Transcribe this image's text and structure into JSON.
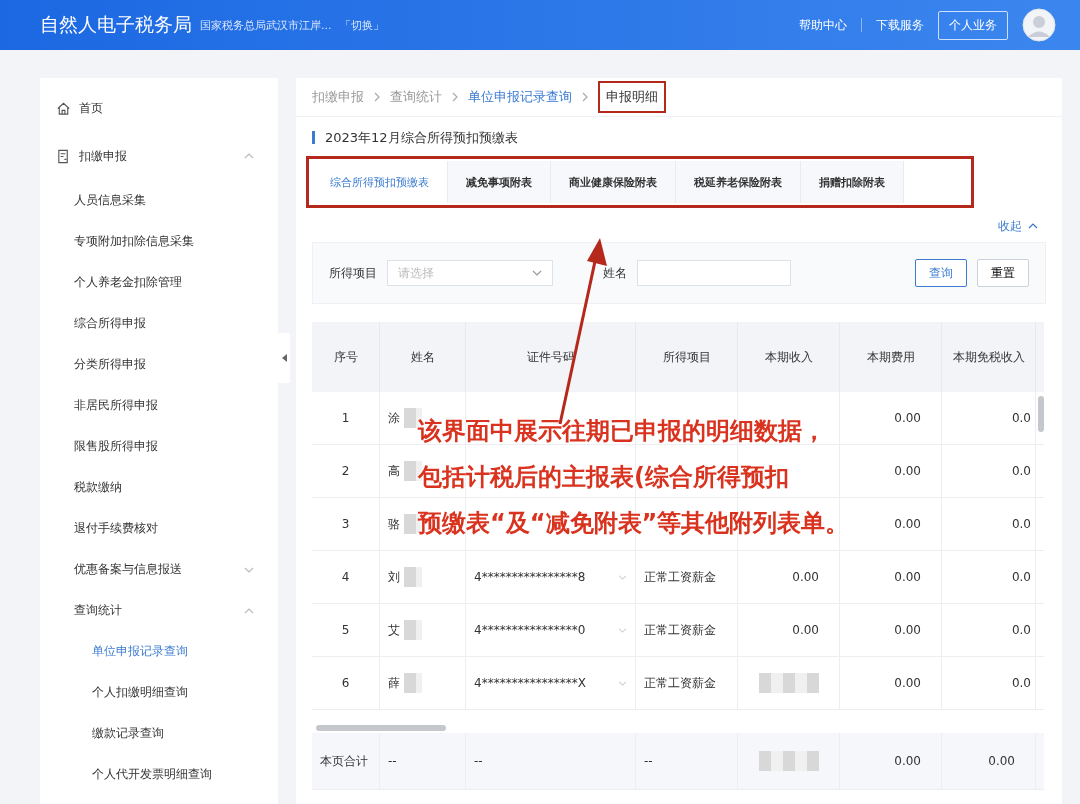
{
  "header": {
    "title": "自然人电子税务局",
    "org": "国家税务总局武汉市江岸...",
    "switch": "「切换」",
    "links": [
      "帮助中心",
      "下载服务"
    ],
    "button": "个人业务"
  },
  "sidebar": {
    "items": [
      {
        "label": "首页",
        "selected": false
      },
      {
        "label": "扣缴申报",
        "selected": false,
        "expanded": true,
        "children": [
          {
            "label": "人员信息采集",
            "selected": false
          },
          {
            "label": "专项附加扣除信息采集",
            "selected": false
          },
          {
            "label": "个人养老金扣除管理",
            "selected": false
          },
          {
            "label": "综合所得申报",
            "selected": false
          },
          {
            "label": "分类所得申报",
            "selected": false
          },
          {
            "label": "非居民所得申报",
            "selected": false
          },
          {
            "label": "限售股所得申报",
            "selected": false
          },
          {
            "label": "税款缴纳",
            "selected": false
          },
          {
            "label": "退付手续费核对",
            "selected": false
          },
          {
            "label": "优惠备案与信息报送",
            "selected": false,
            "expanded": false
          },
          {
            "label": "查询统计",
            "selected": false,
            "expanded": true,
            "children": [
              {
                "label": "单位申报记录查询",
                "selected": true
              },
              {
                "label": "个人扣缴明细查询",
                "selected": false
              },
              {
                "label": "缴款记录查询",
                "selected": false
              },
              {
                "label": "个人代开发票明细查询",
                "selected": false
              }
            ]
          }
        ]
      }
    ]
  },
  "breadcrumb": [
    {
      "label": "扣缴申报",
      "kind": "plain"
    },
    {
      "label": "查询统计",
      "kind": "plain"
    },
    {
      "label": "单位申报记录查询",
      "kind": "link"
    },
    {
      "label": "申报明细",
      "kind": "current"
    }
  ],
  "section_title": "2023年12月综合所得预扣预缴表",
  "tabs": [
    {
      "label": "综合所得预扣预缴表",
      "selected": true
    },
    {
      "label": "减免事项附表",
      "selected": false
    },
    {
      "label": "商业健康保险附表",
      "selected": false
    },
    {
      "label": "税延养老保险附表",
      "selected": false
    },
    {
      "label": "捐赠扣除附表",
      "selected": false
    }
  ],
  "collapse_link": "收起",
  "filters": {
    "income_item": {
      "label": "所得项目",
      "placeholder": "请选择"
    },
    "name": {
      "label": "姓名"
    },
    "buttons": [
      "查询",
      "重置"
    ]
  },
  "table": {
    "columns": [
      "序号",
      "姓名",
      "证件号码",
      "所得项目",
      "本期收入",
      "本期费用",
      "本期免税收入"
    ],
    "rows": [
      {
        "no": "1",
        "name": "涂",
        "id": "",
        "item": "",
        "income": "",
        "income_blurred": false,
        "expense": "0.00",
        "exempt": "0.0"
      },
      {
        "no": "2",
        "name": "高",
        "id": "",
        "item": "",
        "income": "",
        "income_blurred": false,
        "expense": "0.00",
        "exempt": "0.0"
      },
      {
        "no": "3",
        "name": "骆",
        "id": "",
        "item": "",
        "income": "",
        "income_blurred": false,
        "expense": "0.00",
        "exempt": "0.0"
      },
      {
        "no": "4",
        "name": "刘",
        "id": "4****************8",
        "item": "正常工资薪金",
        "income": "0.00",
        "income_blurred": false,
        "expense": "0.00",
        "exempt": "0.0"
      },
      {
        "no": "5",
        "name": "艾",
        "id": "4****************0",
        "item": "正常工资薪金",
        "income": "0.00",
        "income_blurred": false,
        "expense": "0.00",
        "exempt": "0.0"
      },
      {
        "no": "6",
        "name": "薛",
        "id": "4****************X",
        "item": "正常工资薪金",
        "income": "",
        "income_blurred": true,
        "expense": "0.00",
        "exempt": "0.0"
      }
    ],
    "total": {
      "label": "本页合计",
      "name": "--",
      "id": "--",
      "item": "--",
      "income_blurred": true,
      "expense": "0.00",
      "exempt": "0.00"
    }
  },
  "annotation": {
    "lines": [
      "该界面中展示往期已申报的明细数据，",
      "包括计税后的主报表(综合所得预扣",
      "预缴表“及“减免附表”等其他附列表单。"
    ]
  }
}
